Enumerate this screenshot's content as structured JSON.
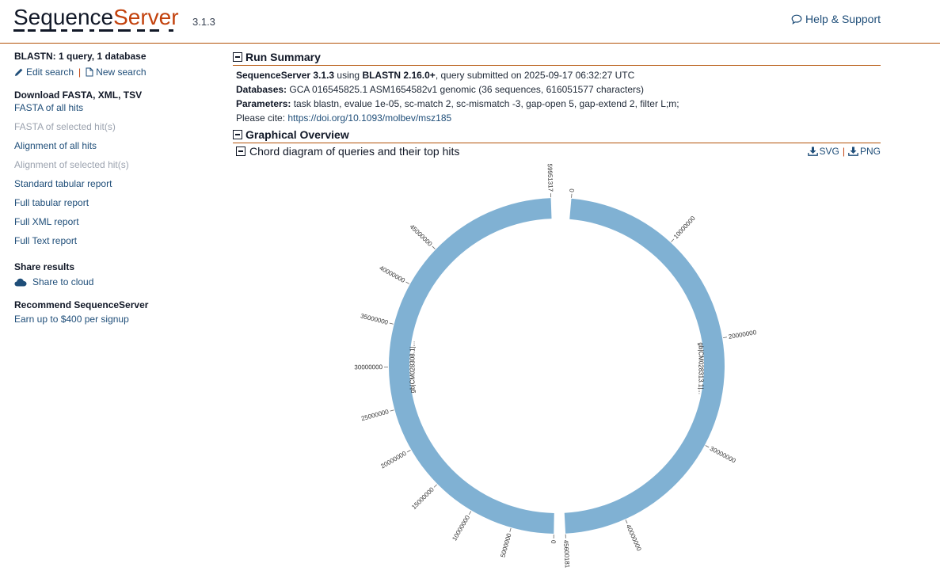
{
  "header": {
    "logo_main": "Sequence",
    "logo_accent": "Server",
    "version": "3.1.3",
    "help_label": "Help & Support"
  },
  "sidebar": {
    "title": "BLASTN: 1 query, 1 database",
    "edit_search": "Edit search",
    "new_search": "New search",
    "download_heading": "Download FASTA, XML, TSV",
    "downloads": [
      {
        "label": "FASTA of all hits",
        "enabled": true
      },
      {
        "label": "FASTA of selected hit(s)",
        "enabled": false
      },
      {
        "label": "Alignment of all hits",
        "enabled": true
      },
      {
        "label": "Alignment of selected hit(s)",
        "enabled": false
      },
      {
        "label": "Standard tabular report",
        "enabled": true
      },
      {
        "label": "Full tabular report",
        "enabled": true
      },
      {
        "label": "Full XML report",
        "enabled": true
      },
      {
        "label": "Full Text report",
        "enabled": true
      }
    ],
    "share_heading": "Share results",
    "share_cloud": "Share to cloud",
    "recommend_heading": "Recommend SequenceServer",
    "recommend_link": "Earn up to $400 per signup"
  },
  "run_summary": {
    "title": "Run Summary",
    "line1_bold1": "SequenceServer 3.1.3",
    "line1_text1": " using ",
    "line1_bold2": "BLASTN 2.16.0+",
    "line1_text2": ", query submitted on 2025-09-17 06:32:27 UTC",
    "databases_label": "Databases:",
    "databases_value": " GCA 016545825.1 ASM1654582v1 genomic (36 sequences, 616051577 characters)",
    "parameters_label": "Parameters:",
    "parameters_value": " task blastn, evalue 1e-05, sc-match 2, sc-mismatch -3, gap-open 5, gap-extend 2, filter L;m;",
    "cite_text": "Please cite: ",
    "cite_link": "https://doi.org/10.1093/molbev/msz185"
  },
  "graphical_overview": {
    "title": "Graphical Overview",
    "chord_title": "Chord diagram of queries and their top hits",
    "svg_label": "SVG",
    "png_label": "PNG"
  },
  "colors": {
    "accent": "#c2410c",
    "link": "#1f4e79",
    "ring": "#80b1d3"
  },
  "chart_data": {
    "type": "chord",
    "arcs": [
      {
        "name": "gb|CM028313.1|...",
        "length": 45600000,
        "start_angle_deg": 5,
        "end_angle_deg": 177,
        "ticks": [
          {
            "value": 0,
            "label": "0"
          },
          {
            "value": 10000000,
            "label": "10000000"
          },
          {
            "value": 20000000,
            "label": "20000000"
          },
          {
            "value": 30000000,
            "label": "30000000"
          },
          {
            "value": 40000000,
            "label": "40000000"
          }
        ],
        "end_label": "45600181"
      },
      {
        "name": "gb|CM028308.1|...",
        "length": 59951317,
        "start_angle_deg": 181,
        "end_angle_deg": 358,
        "ticks": [
          {
            "value": 0,
            "label": "0"
          },
          {
            "value": 5000000,
            "label": "5000000"
          },
          {
            "value": 10000000,
            "label": "10000000"
          },
          {
            "value": 15000000,
            "label": "15000000"
          },
          {
            "value": 20000000,
            "label": "20000000"
          },
          {
            "value": 25000000,
            "label": "25000000"
          },
          {
            "value": 30000000,
            "label": "30000000"
          },
          {
            "value": 35000000,
            "label": "35000000"
          },
          {
            "value": 40000000,
            "label": "40000000"
          },
          {
            "value": 45000000,
            "label": "45000000"
          }
        ],
        "end_label": "59951317"
      }
    ]
  }
}
